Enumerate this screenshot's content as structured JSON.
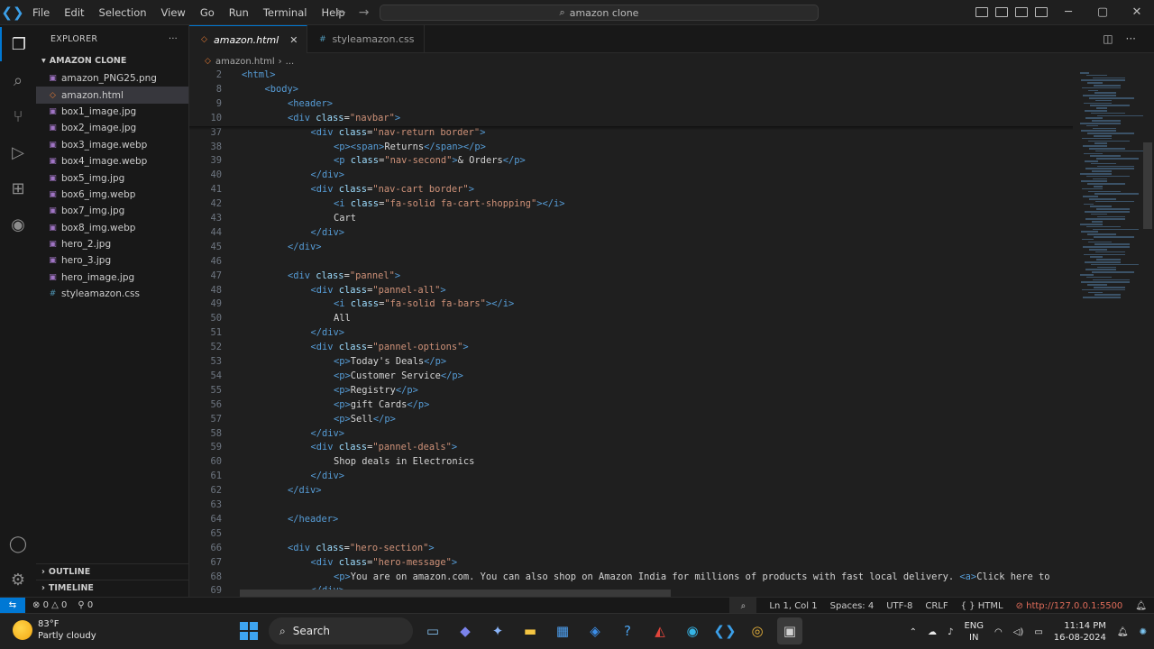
{
  "titlebar": {
    "menus": [
      "File",
      "Edit",
      "Selection",
      "View",
      "Go",
      "Run",
      "Terminal",
      "Help"
    ],
    "search": "amazon clone"
  },
  "sidebar": {
    "title": "EXPLORER",
    "folder": "AMAZON CLONE",
    "files": [
      {
        "name": "amazon_PNG25.png",
        "type": "img"
      },
      {
        "name": "amazon.html",
        "type": "html"
      },
      {
        "name": "box1_image.jpg",
        "type": "img"
      },
      {
        "name": "box2_image.jpg",
        "type": "img"
      },
      {
        "name": "box3_image.webp",
        "type": "img"
      },
      {
        "name": "box4_image.webp",
        "type": "img"
      },
      {
        "name": "box5_img.jpg",
        "type": "img"
      },
      {
        "name": "box6_img.webp",
        "type": "img"
      },
      {
        "name": "box7_img.jpg",
        "type": "img"
      },
      {
        "name": "box8_img.webp",
        "type": "img"
      },
      {
        "name": "hero_2.jpg",
        "type": "img"
      },
      {
        "name": "hero_3.jpg",
        "type": "img"
      },
      {
        "name": "hero_image.jpg",
        "type": "img"
      },
      {
        "name": "styleamazon.css",
        "type": "css"
      }
    ],
    "outline": "OUTLINE",
    "timeline": "TIMELINE"
  },
  "tabs": [
    {
      "label": "amazon.html",
      "active": true
    },
    {
      "label": "styleamazon.css",
      "active": false
    }
  ],
  "breadcrumb": {
    "file": "amazon.html",
    "rest": "..."
  },
  "code_lines": [
    {
      "n": "2",
      "indent": 0,
      "parts": [
        [
          "tg",
          "<html>"
        ]
      ]
    },
    {
      "n": "8",
      "indent": 1,
      "parts": [
        [
          "tg",
          "<body>"
        ]
      ]
    },
    {
      "n": "9",
      "indent": 2,
      "parts": [
        [
          "tg",
          "<header>"
        ]
      ]
    },
    {
      "n": "10",
      "indent": 2,
      "parts": [
        [
          "tg",
          "<div "
        ],
        [
          "at",
          "class"
        ],
        [
          "tx",
          "="
        ],
        [
          "st",
          "\"navbar\""
        ],
        [
          "tg",
          ">"
        ]
      ]
    },
    {
      "n": "37",
      "indent": 3,
      "parts": [
        [
          "tg",
          "<div "
        ],
        [
          "at",
          "class"
        ],
        [
          "tx",
          "="
        ],
        [
          "st",
          "\"nav-return border\""
        ],
        [
          "tg",
          ">"
        ]
      ]
    },
    {
      "n": "38",
      "indent": 4,
      "parts": [
        [
          "tg",
          "<p><span>"
        ],
        [
          "tx",
          "Returns"
        ],
        [
          "tg",
          "</span></p>"
        ]
      ]
    },
    {
      "n": "39",
      "indent": 4,
      "parts": [
        [
          "tg",
          "<p "
        ],
        [
          "at",
          "class"
        ],
        [
          "tx",
          "="
        ],
        [
          "st",
          "\"nav-second\""
        ],
        [
          "tg",
          ">"
        ],
        [
          "tx",
          "& Orders"
        ],
        [
          "tg",
          "</p>"
        ]
      ]
    },
    {
      "n": "40",
      "indent": 3,
      "parts": [
        [
          "tg",
          "</div>"
        ]
      ]
    },
    {
      "n": "41",
      "indent": 3,
      "parts": [
        [
          "tg",
          "<div "
        ],
        [
          "at",
          "class"
        ],
        [
          "tx",
          "="
        ],
        [
          "st",
          "\"nav-cart border\""
        ],
        [
          "tg",
          ">"
        ]
      ]
    },
    {
      "n": "42",
      "indent": 4,
      "parts": [
        [
          "tg",
          "<i "
        ],
        [
          "at",
          "class"
        ],
        [
          "tx",
          "="
        ],
        [
          "st",
          "\"fa-solid fa-cart-shopping\""
        ],
        [
          "tg",
          "></i>"
        ]
      ]
    },
    {
      "n": "43",
      "indent": 4,
      "parts": [
        [
          "tx",
          "Cart"
        ]
      ]
    },
    {
      "n": "44",
      "indent": 3,
      "parts": [
        [
          "tg",
          "</div>"
        ]
      ]
    },
    {
      "n": "45",
      "indent": 2,
      "parts": [
        [
          "tg",
          "</div>"
        ]
      ]
    },
    {
      "n": "46",
      "indent": 0,
      "parts": []
    },
    {
      "n": "47",
      "indent": 2,
      "parts": [
        [
          "tg",
          "<div "
        ],
        [
          "at",
          "class"
        ],
        [
          "tx",
          "="
        ],
        [
          "st",
          "\"pannel\""
        ],
        [
          "tg",
          ">"
        ]
      ]
    },
    {
      "n": "48",
      "indent": 3,
      "parts": [
        [
          "tg",
          "<div "
        ],
        [
          "at",
          "class"
        ],
        [
          "tx",
          "="
        ],
        [
          "st",
          "\"pannel-all\""
        ],
        [
          "tg",
          ">"
        ]
      ]
    },
    {
      "n": "49",
      "indent": 4,
      "parts": [
        [
          "tg",
          "<i "
        ],
        [
          "at",
          "class"
        ],
        [
          "tx",
          "="
        ],
        [
          "st",
          "\"fa-solid fa-bars\""
        ],
        [
          "tg",
          "></i>"
        ]
      ]
    },
    {
      "n": "50",
      "indent": 4,
      "parts": [
        [
          "tx",
          "All"
        ]
      ]
    },
    {
      "n": "51",
      "indent": 3,
      "parts": [
        [
          "tg",
          "</div>"
        ]
      ]
    },
    {
      "n": "52",
      "indent": 3,
      "parts": [
        [
          "tg",
          "<div "
        ],
        [
          "at",
          "class"
        ],
        [
          "tx",
          "="
        ],
        [
          "st",
          "\"pannel-options\""
        ],
        [
          "tg",
          ">"
        ]
      ]
    },
    {
      "n": "53",
      "indent": 4,
      "parts": [
        [
          "tg",
          "<p>"
        ],
        [
          "tx",
          "Today's Deals"
        ],
        [
          "tg",
          "</p>"
        ]
      ]
    },
    {
      "n": "54",
      "indent": 4,
      "parts": [
        [
          "tg",
          "<p>"
        ],
        [
          "tx",
          "Customer Service"
        ],
        [
          "tg",
          "</p>"
        ]
      ]
    },
    {
      "n": "55",
      "indent": 4,
      "parts": [
        [
          "tg",
          "<p>"
        ],
        [
          "tx",
          "Registry"
        ],
        [
          "tg",
          "</p>"
        ]
      ]
    },
    {
      "n": "56",
      "indent": 4,
      "parts": [
        [
          "tg",
          "<p>"
        ],
        [
          "tx",
          "gift Cards"
        ],
        [
          "tg",
          "</p>"
        ]
      ]
    },
    {
      "n": "57",
      "indent": 4,
      "parts": [
        [
          "tg",
          "<p>"
        ],
        [
          "tx",
          "Sell"
        ],
        [
          "tg",
          "</p>"
        ]
      ]
    },
    {
      "n": "58",
      "indent": 3,
      "parts": [
        [
          "tg",
          "</div>"
        ]
      ]
    },
    {
      "n": "59",
      "indent": 3,
      "parts": [
        [
          "tg",
          "<div "
        ],
        [
          "at",
          "class"
        ],
        [
          "tx",
          "="
        ],
        [
          "st",
          "\"pannel-deals\""
        ],
        [
          "tg",
          ">"
        ]
      ]
    },
    {
      "n": "60",
      "indent": 4,
      "parts": [
        [
          "tx",
          "Shop deals in Electronics"
        ]
      ]
    },
    {
      "n": "61",
      "indent": 3,
      "parts": [
        [
          "tg",
          "</div>"
        ]
      ]
    },
    {
      "n": "62",
      "indent": 2,
      "parts": [
        [
          "tg",
          "</div>"
        ]
      ]
    },
    {
      "n": "63",
      "indent": 0,
      "parts": []
    },
    {
      "n": "64",
      "indent": 2,
      "parts": [
        [
          "tg",
          "</header>"
        ]
      ]
    },
    {
      "n": "65",
      "indent": 0,
      "parts": []
    },
    {
      "n": "66",
      "indent": 2,
      "parts": [
        [
          "tg",
          "<div "
        ],
        [
          "at",
          "class"
        ],
        [
          "tx",
          "="
        ],
        [
          "st",
          "\"hero-section\""
        ],
        [
          "tg",
          ">"
        ]
      ]
    },
    {
      "n": "67",
      "indent": 3,
      "parts": [
        [
          "tg",
          "<div "
        ],
        [
          "at",
          "class"
        ],
        [
          "tx",
          "="
        ],
        [
          "st",
          "\"hero-message\""
        ],
        [
          "tg",
          ">"
        ]
      ]
    },
    {
      "n": "68",
      "indent": 4,
      "parts": [
        [
          "tg",
          "<p>"
        ],
        [
          "tx",
          "You are on amazon.com. You can also shop on Amazon India for millions of products with fast local delivery. "
        ],
        [
          "tg",
          "<a>"
        ],
        [
          "tx",
          "Click here to"
        ]
      ]
    },
    {
      "n": "69",
      "indent": 3,
      "parts": [
        [
          "tg",
          "</div>"
        ]
      ]
    }
  ],
  "statusbar": {
    "errors": "0",
    "warnings": "0",
    "ports": "0",
    "cursor": "Ln 1, Col 1",
    "spaces": "Spaces: 4",
    "encoding": "UTF-8",
    "eol": "CRLF",
    "language": "HTML",
    "golive": "http://127.0.0.1:5500"
  },
  "taskbar": {
    "temp": "83°F",
    "weather": "Partly cloudy",
    "search": "Search",
    "lang1": "ENG",
    "lang2": "IN",
    "time": "11:14 PM",
    "date": "16-08-2024"
  },
  "colors": {
    "accent": "#0078d4",
    "tag": "#569cd6",
    "attr": "#9cdcfe",
    "string": "#ce9178"
  }
}
